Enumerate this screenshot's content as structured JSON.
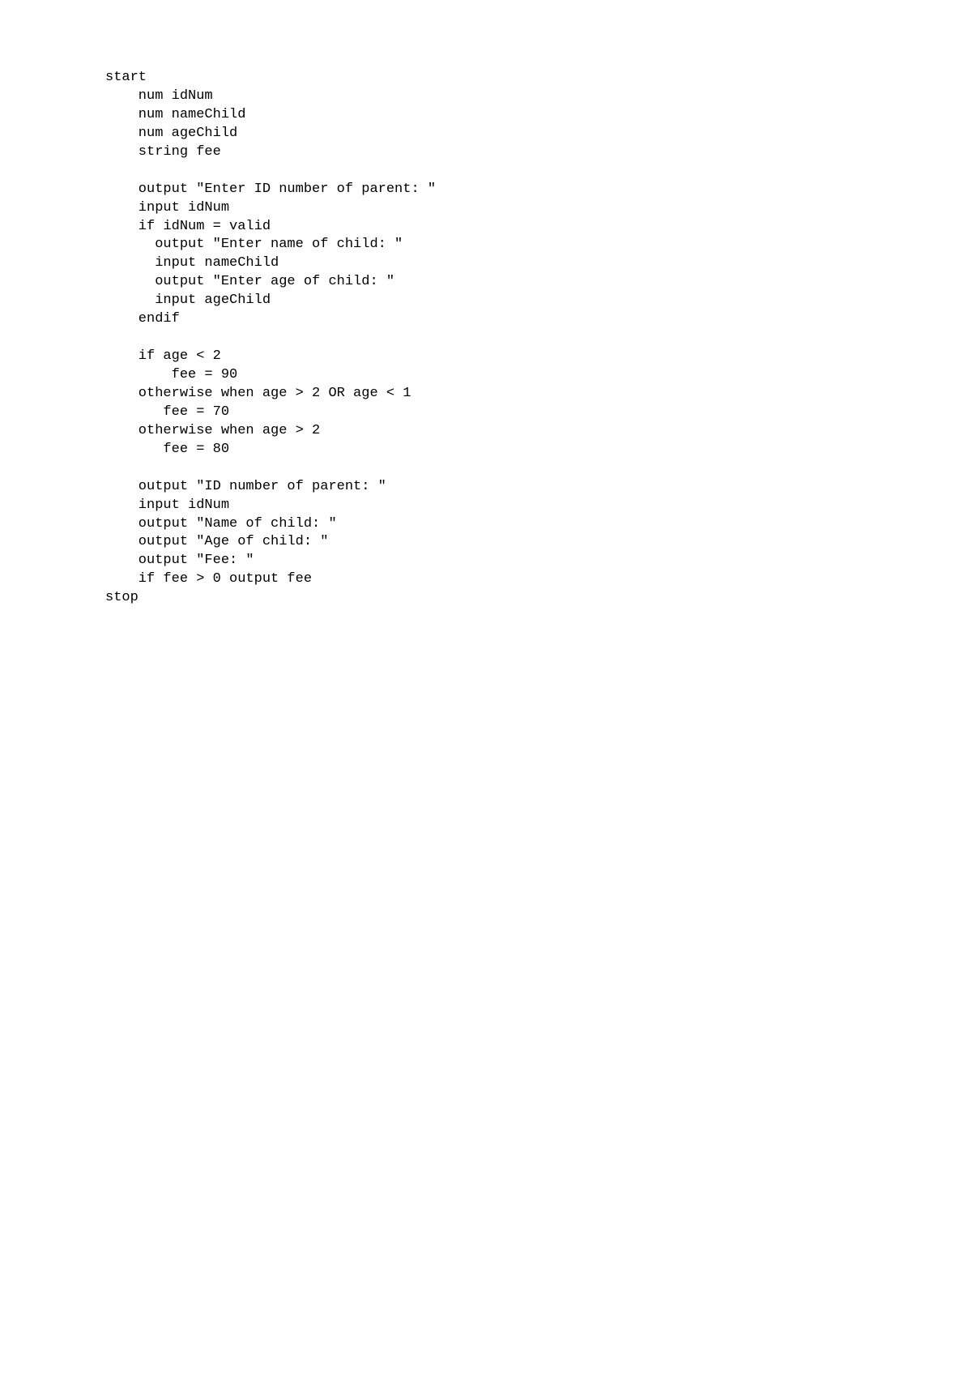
{
  "code": {
    "lines": [
      "start",
      "    num idNum",
      "    num nameChild",
      "    num ageChild",
      "    string fee",
      "",
      "    output \"Enter ID number of parent: \"",
      "    input idNum",
      "    if idNum = valid",
      "      output \"Enter name of child: \"",
      "      input nameChild",
      "      output \"Enter age of child: \"",
      "      input ageChild",
      "    endif",
      "",
      "    if age < 2",
      "        fee = 90",
      "    otherwise when age > 2 OR age < 1",
      "       fee = 70",
      "    otherwise when age > 2",
      "       fee = 80",
      "",
      "    output \"ID number of parent: \"",
      "    input idNum",
      "    output \"Name of child: \"",
      "    output \"Age of child: \"",
      "    output \"Fee: \"",
      "    if fee > 0 output fee",
      "stop"
    ]
  }
}
